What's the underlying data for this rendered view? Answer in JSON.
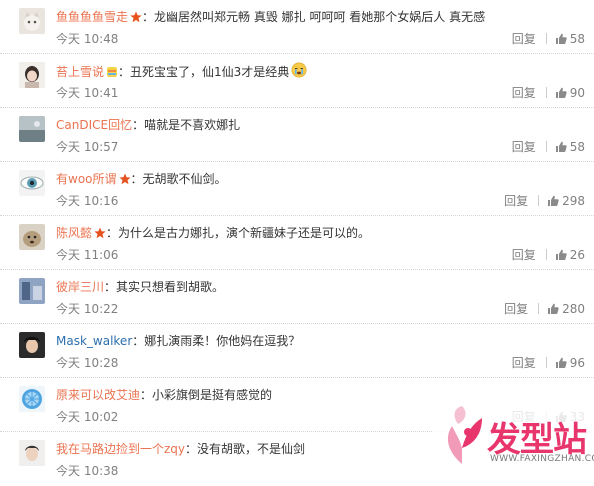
{
  "comments": [
    {
      "user": "鱼鱼鱼鱼雪走",
      "text": "：龙幽居然叫郑元畅 真毁 娜扎 呵呵呵 看她那个女娲后人 真无感",
      "time": "今天 10:48",
      "reply": "回复",
      "likes": "58"
    },
    {
      "user": "苔上雪说",
      "text": "：丑死宝宝了，仙1仙3才是经典",
      "time": "今天 10:41",
      "reply": "回复",
      "likes": "90"
    },
    {
      "user": "CanDICE回忆",
      "text": "：喵就是不喜欢娜扎",
      "time": "今天 10:57",
      "reply": "回复",
      "likes": "58"
    },
    {
      "user": "有woo所谓",
      "text": "：无胡歌不仙剑。",
      "time": "今天 10:16",
      "reply": "回复",
      "likes": "298"
    },
    {
      "user": "陈风懿",
      "text": "：为什么是古力娜扎，演个新疆妹子还是可以的。",
      "time": "今天 11:06",
      "reply": "回复",
      "likes": "26"
    },
    {
      "user": "彼岸三川",
      "text": "：其实只想看到胡歌。",
      "time": "今天 10:22",
      "reply": "回复",
      "likes": "280"
    },
    {
      "user": "Mask_walker",
      "text": "：娜扎演雨柔！你他妈在逗我？",
      "time": "今天 10:28",
      "reply": "回复",
      "likes": "96"
    },
    {
      "user": "原来可以改艾迪",
      "text": "：小彩旗倒是挺有感觉的",
      "time": "今天 10:02",
      "reply": "回复",
      "likes": "33"
    },
    {
      "user": "我在马路边捡到一个zqy",
      "text": "：没有胡歌，不是仙剑",
      "time": "今天 10:38",
      "reply": "回复",
      "likes": ""
    }
  ],
  "watermark": {
    "logo_text": "发型站",
    "url": "WWW.FAXINGZHAN.COM"
  },
  "colors": {
    "username": "#eb7350",
    "username_alt": "#2d6fae",
    "meta": "#808080",
    "badge": "#e6521f"
  }
}
